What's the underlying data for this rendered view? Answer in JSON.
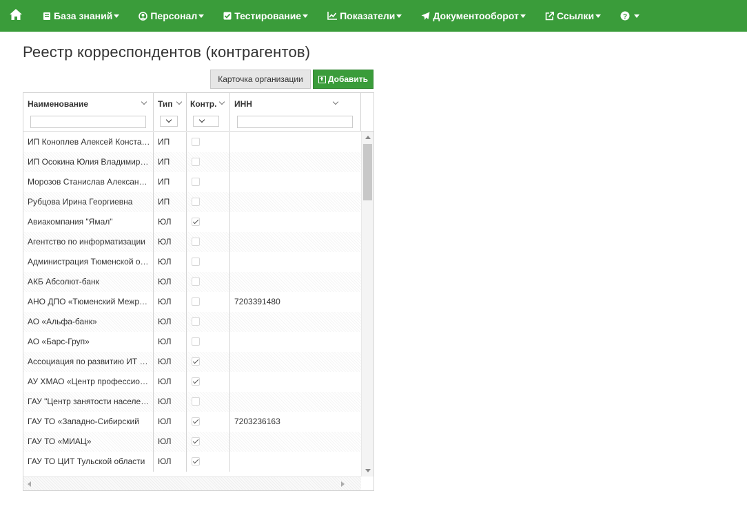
{
  "navbar": {
    "bg_color": "#3a9c3a",
    "home_icon": "home-icon",
    "items": [
      {
        "label": "База знаний",
        "icon": "book-icon"
      },
      {
        "label": "Персонал",
        "icon": "user-circle-icon"
      },
      {
        "label": "Тестирование",
        "icon": "check-square-icon"
      },
      {
        "label": "Показатели",
        "icon": "line-chart-icon"
      },
      {
        "label": "Документооборот",
        "icon": "paper-plane-icon"
      },
      {
        "label": "Ссылки",
        "icon": "external-link-icon"
      },
      {
        "label": "",
        "icon": "question-circle-icon"
      }
    ]
  },
  "page": {
    "title": "Реестр корреспондентов (контрагентов)"
  },
  "toolbar": {
    "card_label": "Карточка организации",
    "add_label": "Добавить"
  },
  "grid": {
    "columns": [
      "Наименование",
      "Тип",
      "Контр.",
      "ИНН"
    ],
    "rows": [
      {
        "name": "ИП Коноплев Алексей Константинович",
        "type": "ИП",
        "counterparty": false,
        "inn": ""
      },
      {
        "name": "ИП Осокина Юлия Владимировна",
        "type": "ИП",
        "counterparty": false,
        "inn": ""
      },
      {
        "name": "Морозов Станислав Александрович",
        "type": "ИП",
        "counterparty": false,
        "inn": ""
      },
      {
        "name": "Рубцова Ирина Георгиевна",
        "type": "ИП",
        "counterparty": false,
        "inn": ""
      },
      {
        "name": "Авиакомпания \"Ямал\"",
        "type": "ЮЛ",
        "counterparty": true,
        "inn": ""
      },
      {
        "name": "Агентство по информатизации",
        "type": "ЮЛ",
        "counterparty": false,
        "inn": ""
      },
      {
        "name": "Администрация Тюменской области",
        "type": "ЮЛ",
        "counterparty": false,
        "inn": ""
      },
      {
        "name": "АКБ Абсолют-банк",
        "type": "ЮЛ",
        "counterparty": false,
        "inn": ""
      },
      {
        "name": "АНО ДПО «Тюменский Межрегиональный",
        "type": "ЮЛ",
        "counterparty": false,
        "inn": "7203391480"
      },
      {
        "name": "АО «Альфа-банк»",
        "type": "ЮЛ",
        "counterparty": false,
        "inn": ""
      },
      {
        "name": "АО «Барс-Груп»",
        "type": "ЮЛ",
        "counterparty": false,
        "inn": ""
      },
      {
        "name": "Ассоциация по развитию ИТ отрасли",
        "type": "ЮЛ",
        "counterparty": true,
        "inn": ""
      },
      {
        "name": "АУ ХМАО «Центр профессиональной",
        "type": "ЮЛ",
        "counterparty": true,
        "inn": ""
      },
      {
        "name": "ГАУ \"Центр занятости населения",
        "type": "ЮЛ",
        "counterparty": false,
        "inn": ""
      },
      {
        "name": "ГАУ ТО «Западно-Сибирский",
        "type": "ЮЛ",
        "counterparty": true,
        "inn": "7203236163"
      },
      {
        "name": "ГАУ ТО «МИАЦ»",
        "type": "ЮЛ",
        "counterparty": true,
        "inn": ""
      },
      {
        "name": "ГАУ ТО ЦИТ Тульской области",
        "type": "ЮЛ",
        "counterparty": true,
        "inn": ""
      }
    ]
  }
}
